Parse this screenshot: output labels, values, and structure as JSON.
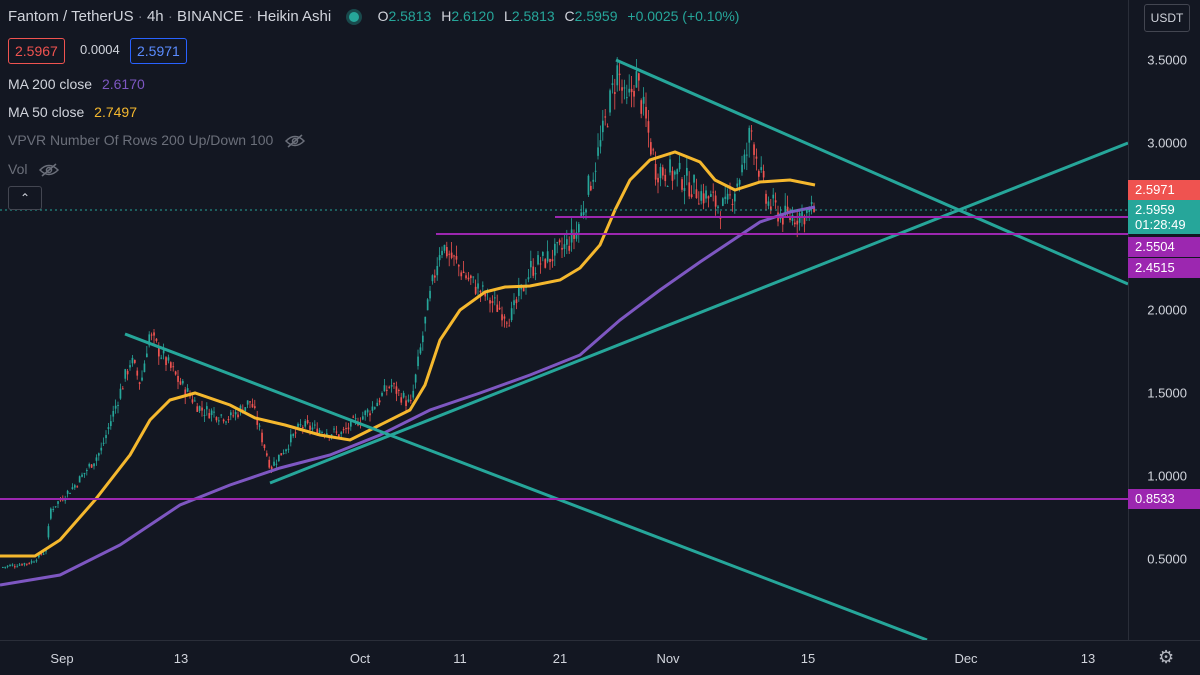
{
  "header": {
    "symbol": "Fantom / TetherUS",
    "interval": "4h",
    "exchange": "BINANCE",
    "chart_style": "Heikin Ashi",
    "ohlc": {
      "open_key": "O",
      "open": "2.5813",
      "high_key": "H",
      "high": "2.6120",
      "low_key": "L",
      "low": "2.5813",
      "close_key": "C",
      "close": "2.5959",
      "change": "+0.0025 (+0.10%)"
    },
    "bid": "2.5967",
    "spread": "0.0004",
    "ask": "2.5971"
  },
  "indicators": {
    "ma200": {
      "name": "MA 200 close",
      "value": "2.6170",
      "color": "#7e57c2"
    },
    "ma50": {
      "name": "MA 50 close",
      "value": "2.7497",
      "color": "#f5b82e"
    },
    "vpvr": {
      "name": "VPVR Number Of Rows 200 Up/Down 100"
    },
    "vol": {
      "name": "Vol"
    },
    "collapse_icon": "chevron-up-icon"
  },
  "currency_button": "USDT",
  "price_axis": {
    "ticks": [
      "3.5000",
      "3.0000",
      "2.5000",
      "2.0000",
      "1.5000",
      "1.0000",
      "0.5000"
    ],
    "labels": {
      "ask": {
        "value": "2.5971",
        "color": "#ef5350"
      },
      "last": {
        "value": "2.5959",
        "countdown": "01:28:49",
        "color": "#26a69a"
      },
      "level1": {
        "value": "2.5504",
        "color": "#9c27b0"
      },
      "level2": {
        "value": "2.4515",
        "color": "#9c27b0"
      },
      "level3": {
        "value": "0.8533",
        "color": "#9c27b0"
      }
    }
  },
  "time_axis": {
    "labels": [
      "Sep",
      "13",
      "Oct",
      "11",
      "21",
      "Nov",
      "15",
      "Dec",
      "13"
    ]
  },
  "colors": {
    "up": "#26a69a",
    "down": "#ef5350",
    "trendline": "#26a69a",
    "horizontal_level": "#9c27b0",
    "ma50": "#f5b82e",
    "ma200": "#7e57c2",
    "background": "#131722"
  },
  "chart_data": {
    "type": "candlestick",
    "ylim": [
      0.3,
      3.6
    ],
    "x_ticks": [
      "Sep",
      "13",
      "Oct",
      "11",
      "21",
      "Nov",
      "15",
      "Dec",
      "13"
    ],
    "close_path": [
      [
        "Aug 24",
        0.45
      ],
      [
        "Aug 27",
        0.48
      ],
      [
        "Sep 1",
        0.55
      ],
      [
        "Sep 3",
        0.8
      ],
      [
        "Sep 5",
        0.95
      ],
      [
        "Sep 7",
        1.15
      ],
      [
        "Sep 9",
        1.7
      ],
      [
        "Sep 10",
        1.55
      ],
      [
        "Sep 11",
        1.85
      ],
      [
        "Sep 14",
        1.55
      ],
      [
        "Sep 17",
        1.4
      ],
      [
        "Sep 20",
        1.35
      ],
      [
        "Sep 23",
        1.45
      ],
      [
        "Sep 25",
        1.05
      ],
      [
        "Sep 28",
        1.3
      ],
      [
        "Oct 1",
        1.25
      ],
      [
        "Oct 4",
        1.4
      ],
      [
        "Oct 6",
        1.55
      ],
      [
        "Oct 8",
        1.42
      ],
      [
        "Oct 9",
        1.95
      ],
      [
        "Oct 10",
        2.4
      ],
      [
        "Oct 12",
        2.2
      ],
      [
        "Oct 14",
        2.05
      ],
      [
        "Oct 16",
        1.95
      ],
      [
        "Oct 18",
        2.25
      ],
      [
        "Oct 21",
        2.35
      ],
      [
        "Oct 23",
        2.45
      ],
      [
        "Oct 25",
        3.0
      ],
      [
        "Oct 26",
        3.45
      ],
      [
        "Oct 27",
        3.2
      ],
      [
        "Oct 28",
        3.4
      ],
      [
        "Oct 30",
        2.85
      ],
      [
        "Nov 1",
        2.8
      ],
      [
        "Nov 3",
        2.7
      ],
      [
        "Nov 5",
        2.6
      ],
      [
        "Nov 8",
        2.9
      ],
      [
        "Nov 9",
        3.1
      ],
      [
        "Nov 11",
        2.65
      ],
      [
        "Nov 13",
        2.55
      ],
      [
        "Nov 15",
        2.6
      ]
    ],
    "moving_averages": [
      {
        "name": "MA 50 close",
        "last": 2.7497
      },
      {
        "name": "MA 200 close",
        "last": 2.617
      }
    ],
    "horizontal_levels": [
      2.5504,
      2.4515,
      0.8533
    ],
    "last_price": 2.5959
  }
}
